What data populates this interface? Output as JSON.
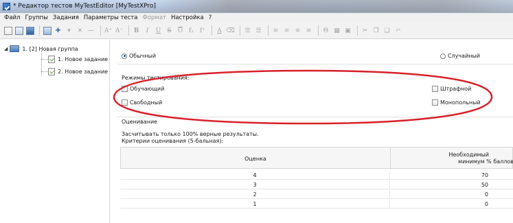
{
  "window": {
    "title": "* Редактор тестов MyTestEditor [MyTestXPro]"
  },
  "menu": {
    "items": [
      {
        "label": "Файл",
        "enabled": true
      },
      {
        "label": "Группы",
        "enabled": true
      },
      {
        "label": "Задания",
        "enabled": true
      },
      {
        "label": "Параметры теста",
        "enabled": true
      },
      {
        "label": "Формат",
        "enabled": false
      },
      {
        "label": "Настройка",
        "enabled": true
      },
      {
        "label": "?",
        "enabled": true
      }
    ]
  },
  "toolbar": {
    "glyphs": {
      "font_grow": "A⁺",
      "font_shrink": "A⁻",
      "bold": "B",
      "italic": "I",
      "underline": "U",
      "strike": "S",
      "overline": "O",
      "subscript": "f₁",
      "superscript": "f¹",
      "color": "A",
      "clear": "⌫",
      "list_bullet": "☰",
      "list_number": "☰",
      "align_left": "≡",
      "align_center": "≡",
      "align_right": "≡",
      "align_justify": "≡",
      "special": "Θ",
      "table": "▦",
      "image": "▣"
    }
  },
  "tree": {
    "group": {
      "label": "1. [2] Новая группа",
      "expand_glyph": "◢"
    },
    "tasks": [
      {
        "label": "1. Новое задание"
      },
      {
        "label": "2. Новое задание"
      }
    ]
  },
  "main": {
    "order": {
      "ordinary_label": "Обычный",
      "ordinary_checked": true,
      "random_label": "Случайный",
      "random_checked": false
    },
    "modes": {
      "title": "Режимы тестирования:",
      "learning_label": "Обучающий",
      "free_label": "Свободный",
      "penalty_label": "Штрафной",
      "monopoly_label": "Монопольный"
    },
    "grading": {
      "title": "Оценивание",
      "note_line1": "Засчитывать только 100% верные результаты.",
      "note_line2": "Критерии оценивания (5-бальная):",
      "col_grade": "Оценка",
      "col_min_line1": "Необходимый",
      "col_min_line2": "минимум % баллов",
      "rows": [
        {
          "grade": "4",
          "min": "70"
        },
        {
          "grade": "3",
          "min": "50"
        },
        {
          "grade": "2",
          "min": "0"
        },
        {
          "grade": "1",
          "min": "0"
        }
      ]
    }
  },
  "colors": {
    "highlight_ellipse": "#d8202a",
    "accent": "#2b5fa8"
  }
}
